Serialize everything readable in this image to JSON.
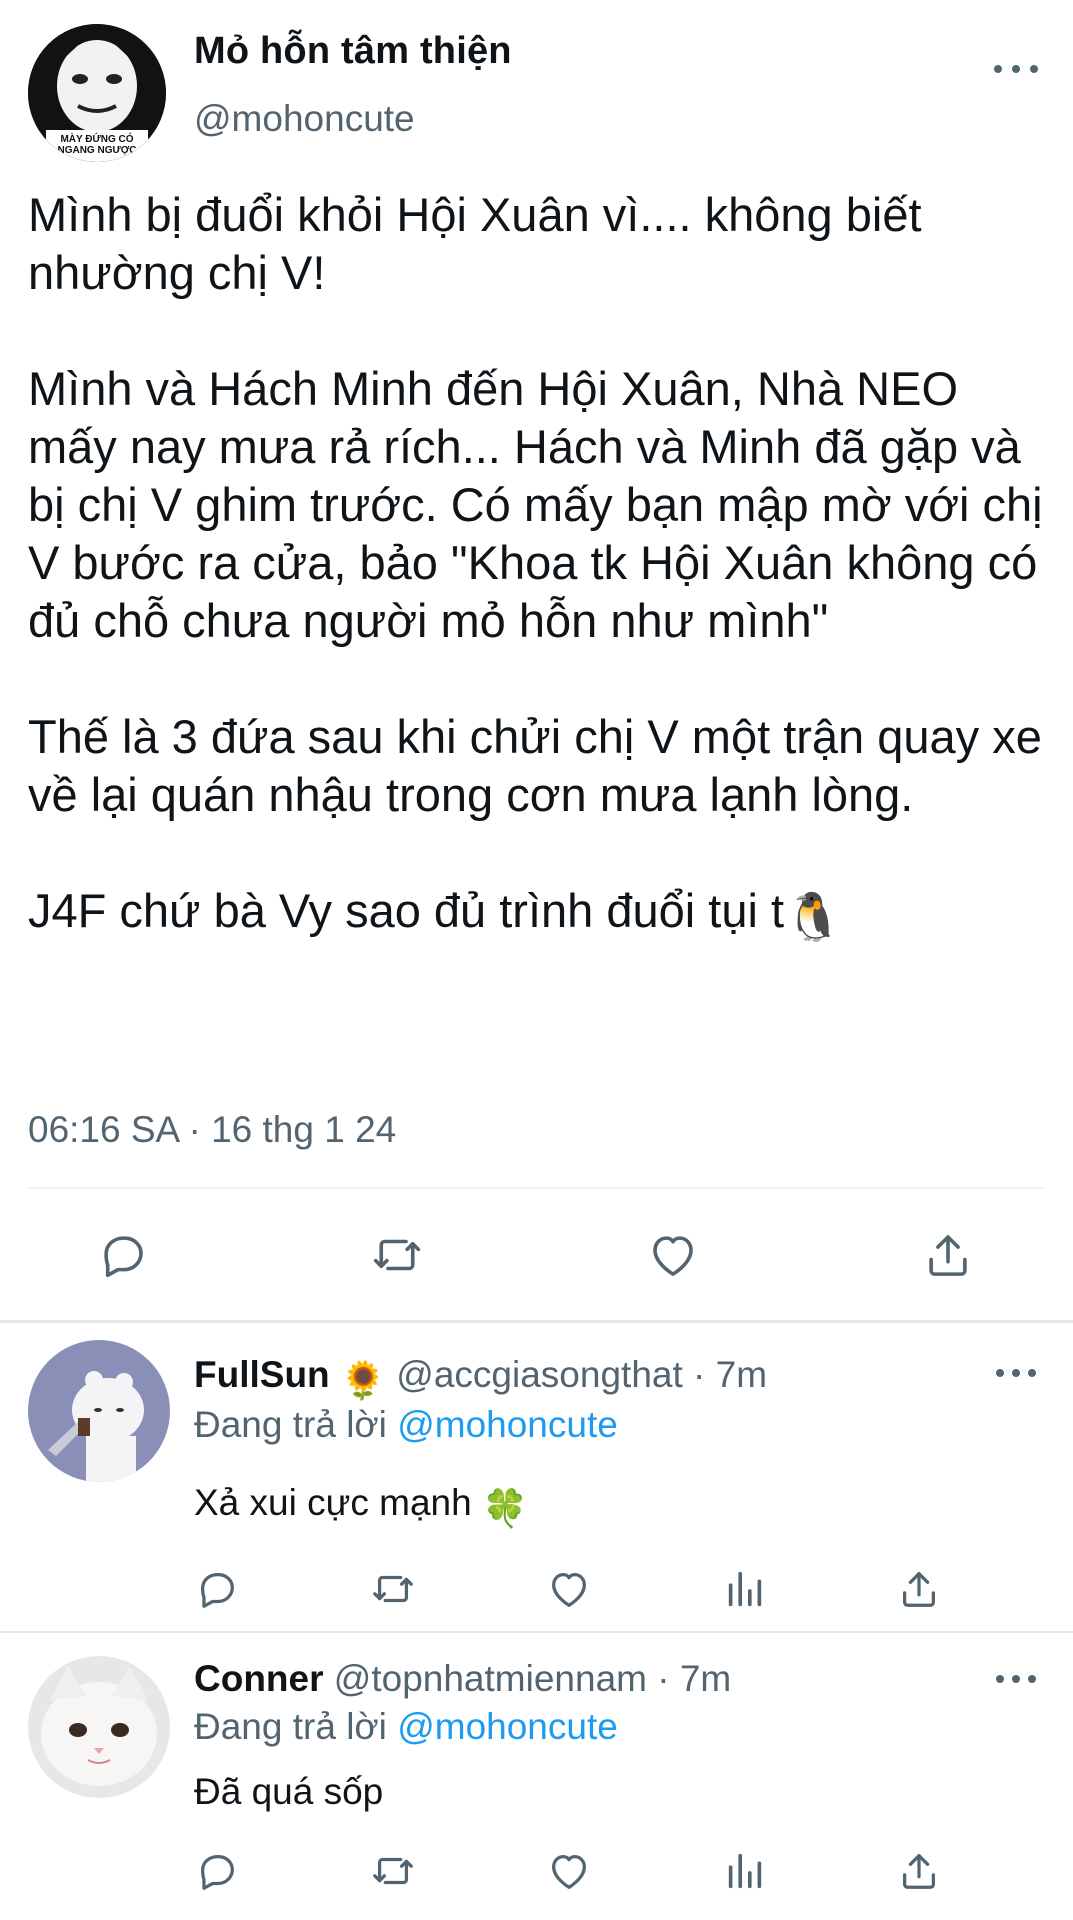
{
  "main_tweet": {
    "author_name": "Mỏ hỗn tâm thiện",
    "author_handle": "@mohoncute",
    "avatar_caption": "MÀY ĐỨNG CÓ NGANG NGƯỢC",
    "paragraphs": [
      "Mình bị đuổi khỏi Hội Xuân vì.... không biết nhường chị V!",
      "Mình và Hách Minh đến Hội Xuân, Nhà NEO mấy nay mưa rả rích... Hách và Minh đã gặp và bị chị V ghim trước. Có mấy bạn mập mờ với chị V bước ra cửa, bảo \"Khoa tk Hội Xuân không có đủ chỗ chưa người mỏ hỗn như mình\"",
      "Thế là 3 đứa sau khi chửi chị V một trận quay xe về lại quán nhậu trong cơn mưa lạnh lòng.",
      "J4F chứ bà Vy sao đủ trình đuổi tụi t"
    ],
    "trailing_emoji": "🐧",
    "timestamp": "06:16 SA · 16 thg 1 24"
  },
  "replies": [
    {
      "name": "FullSun",
      "name_emoji": "🌻",
      "meta": "@accgiasongthat · 7m",
      "replying_prefix": "Đang trả lời",
      "replying_mention": "@mohoncute",
      "text": "Xả xui cực mạnh",
      "text_emoji": "🍀"
    },
    {
      "name": "Conner",
      "meta": "@topnhatmiennam · 7m",
      "replying_prefix": "Đang trả lời",
      "replying_mention": "@mohoncute",
      "text": "Đã quá sốp"
    }
  ],
  "icons": {
    "reply": "reply-icon",
    "retweet": "retweet-icon",
    "like": "heart-icon",
    "share": "share-icon",
    "views": "views-icon",
    "more": "more-icon"
  },
  "colors": {
    "text_primary": "#0f1419",
    "text_secondary": "#536471",
    "accent": "#1d9bf0",
    "divider": "#eff3f4"
  }
}
